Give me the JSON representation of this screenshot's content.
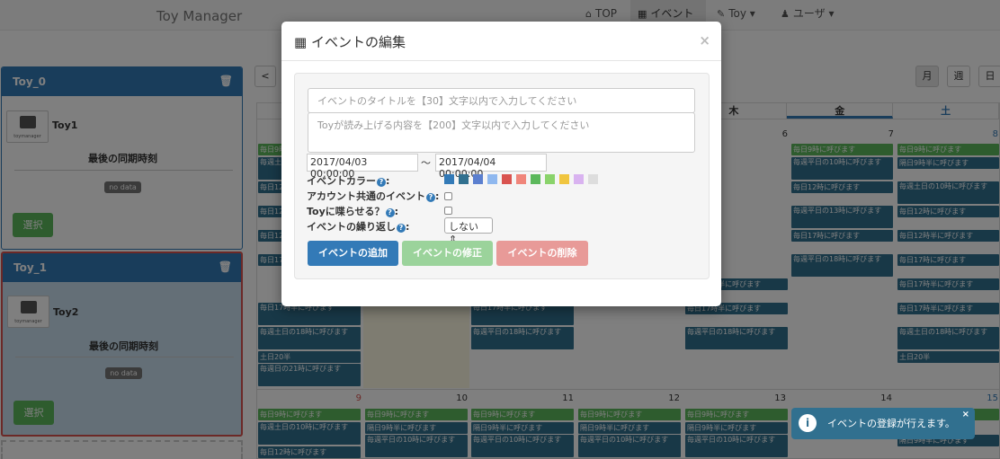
{
  "navbar": {
    "brand": "Toy Manager",
    "items": [
      {
        "label": "TOP",
        "icon": "home-icon"
      },
      {
        "label": "イベント",
        "icon": "calendar-icon"
      },
      {
        "label": "Toy ▾",
        "icon": "wrench-icon"
      },
      {
        "label": "ユーザ ▾",
        "icon": "user-icon"
      }
    ]
  },
  "toys": [
    {
      "header": "Toy_0",
      "name": "Toy1",
      "sync_label": "最後の同期時刻",
      "sync_value": "no data",
      "select_label": "選択",
      "avatar_caption": "toymanager"
    },
    {
      "header": "Toy_1",
      "name": "Toy2",
      "sync_label": "最後の同期時刻",
      "sync_value": "no data",
      "select_label": "選択",
      "avatar_caption": "toymanager"
    }
  ],
  "calendar": {
    "prev_label": "<",
    "view_buttons": [
      "月",
      "週",
      "日"
    ],
    "weekdays": [
      "",
      "",
      "",
      "",
      "木",
      "金",
      "土"
    ],
    "row1_numbers": [
      "",
      "",
      "",
      "",
      "",
      "6",
      "7",
      "8"
    ],
    "row2_numbers": [
      "9",
      "10",
      "11",
      "12",
      "13",
      "14",
      "15"
    ],
    "events": {
      "e1": "毎日9時に呼びます",
      "e2": "毎週土日の10時に呼びます",
      "e3": "毎日12時に呼びます",
      "e4": "毎週平日の10時に呼びます",
      "e5": "隔日9時半に呼びます",
      "e6": "毎日9時に呼びます",
      "e7": "毎日12時に呼びます",
      "e8": "毎週平日の13時に呼びます",
      "e9": "毎日12時に呼びます",
      "e10": "毎日17時半に呼びます",
      "e11": "毎日12時半に呼びます",
      "e12": "毎日17時に呼びます",
      "e13": "毎日12時半に呼びます",
      "e14": "毎週平日の13時に呼びます",
      "e15": "毎週平日の18時に呼びます",
      "e16": "毎日17時半に呼びます",
      "e17": "毎週平日の18時に呼びます",
      "e18": "毎日17時に呼びます",
      "e19": "毎日17時半に呼びます",
      "e20": "毎日17時半に呼びます",
      "e21": "毎週土日の18時に呼びます",
      "e22": "毎週土日の18時に呼びます",
      "e23": "土日20半",
      "e24": "土日20半",
      "e25": "毎週日の21時に呼びます",
      "e26": "毎週平日の18時に呼びます",
      "e27": "毎日17時半に呼びます",
      "e28": "毎週平日の18時に呼びます",
      "e29": "毎週平日の18時に呼びます",
      "e30": "毎週平日の10時に呼びます",
      "e31": "毎日12時半に呼びます"
    }
  },
  "modal": {
    "title": "イベントの編集",
    "close": "×",
    "title_placeholder": "イベントのタイトルを【30】文字以内で入力してください",
    "body_placeholder": "Toyが読み上げる内容を【200】文字以内で入力してください",
    "start": "2017/04/03 00:00:00",
    "tilde": "〜",
    "end": "2017/04/04 00:00:00",
    "color_label": "イベントカラー",
    "colors": [
      "#337ab7",
      "#31708f",
      "#5b7fcf",
      "#8fb8ef",
      "#d9534f",
      "#f0857a",
      "#5cb85c",
      "#8ad36b",
      "#f0c53f",
      "#d9b3f0",
      "#dddddd"
    ],
    "shared_label": "アカウント共通のイベント",
    "speak_label": "Toyに喋らせる？",
    "repeat_label": "イベントの繰り返し",
    "repeat_value": "しない",
    "add_btn": "イベントの追加",
    "edit_btn": "イベントの修正",
    "delete_btn": "イベントの削除"
  },
  "toast": {
    "text": "イベントの登録が行えます。",
    "close": "×"
  }
}
